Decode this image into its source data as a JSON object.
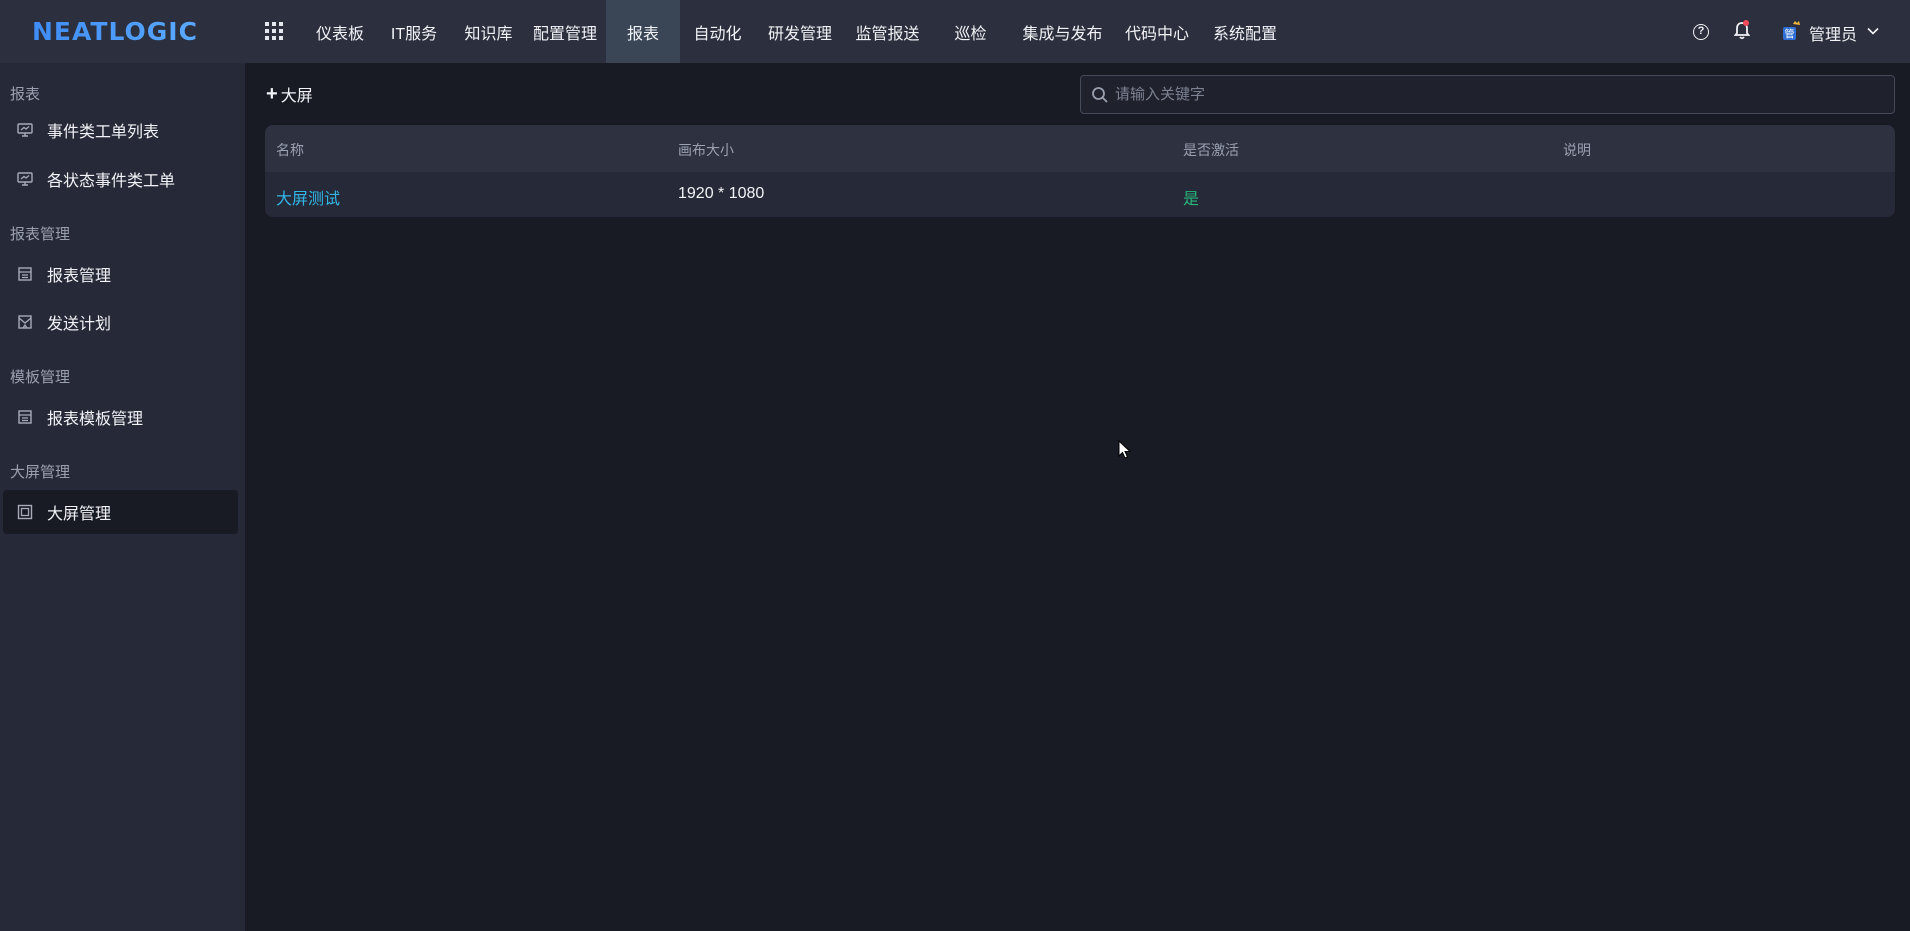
{
  "brand": {
    "logo_text": "NEATLOGIC",
    "accent": "#4f8ef7"
  },
  "nav": {
    "items": [
      "仪表板",
      "IT服务",
      "知识库",
      "配置管理",
      "报表",
      "自动化",
      "研发管理",
      "监管报送",
      "巡检",
      "集成与发布",
      "代码中心",
      "系统配置"
    ],
    "active": "报表"
  },
  "header": {
    "help_icon": "help-icon",
    "help_glyph": "?",
    "bell_icon": "bell-icon",
    "avatar_icon": "user-avatar-icon",
    "user_name": "管理员"
  },
  "sidebar": {
    "groups": [
      {
        "title": "报表",
        "items": [
          {
            "label": "事件类工单列表",
            "icon": "monitor-chart-icon"
          },
          {
            "label": "各状态事件类工单",
            "icon": "monitor-chart-icon"
          }
        ]
      },
      {
        "title": "报表管理",
        "items": [
          {
            "label": "报表管理",
            "icon": "report-icon"
          },
          {
            "label": "发送计划",
            "icon": "mail-plan-icon"
          }
        ]
      },
      {
        "title": "模板管理",
        "items": [
          {
            "label": "报表模板管理",
            "icon": "report-icon"
          }
        ]
      },
      {
        "title": "大屏管理",
        "items": [
          {
            "label": "大屏管理",
            "icon": "screen-icon",
            "active": true
          }
        ]
      }
    ]
  },
  "toolbar": {
    "add_label": "大屏",
    "add_glyph": "+",
    "search_placeholder": "请输入关键字"
  },
  "table": {
    "columns": [
      "名称",
      "画布大小",
      "是否激活",
      "说明"
    ],
    "rows": [
      {
        "name": "大屏测试",
        "size": "1920 * 1080",
        "active": "是",
        "desc": ""
      }
    ]
  },
  "colors": {
    "link": "#33b7e8",
    "success": "#27b67c",
    "bg": "#181a24",
    "sidebar_bg": "#262937",
    "topbar_bg": "#2c2f3d"
  }
}
